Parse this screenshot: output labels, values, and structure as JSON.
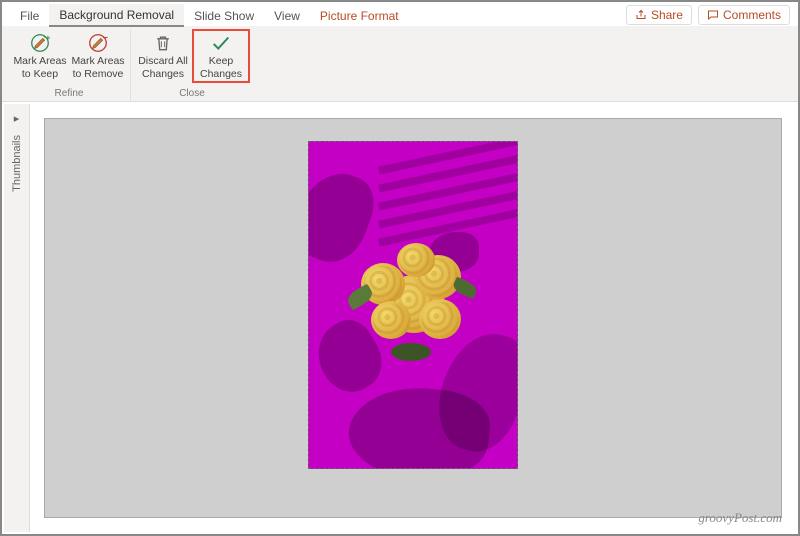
{
  "tabs": {
    "file": "File",
    "bg_removal": "Background Removal",
    "slideshow": "Slide Show",
    "view": "View",
    "picture_format": "Picture Format"
  },
  "actions": {
    "share": "Share",
    "comments": "Comments"
  },
  "ribbon": {
    "refine": {
      "label": "Refine",
      "mark_keep_l1": "Mark Areas",
      "mark_keep_l2": "to Keep",
      "mark_remove_l1": "Mark Areas",
      "mark_remove_l2": "to Remove"
    },
    "close": {
      "label": "Close",
      "discard_l1": "Discard All",
      "discard_l2": "Changes",
      "keep_l1": "Keep",
      "keep_l2": "Changes"
    }
  },
  "thumbnails": {
    "label": "Thumbnails"
  },
  "watermark": "groovyPost.com",
  "icons": {
    "pencil_plus": "pencil-plus-icon",
    "pencil_minus": "pencil-minus-icon",
    "trash": "trash-icon",
    "check": "check-icon",
    "share": "share-icon",
    "comment": "comment-icon",
    "chevron": "chevron-right-icon"
  },
  "colors": {
    "highlight": "#e74c3c",
    "bg_removal_mask": "#c400c4",
    "accent_green": "#2e8b57",
    "accent_red": "#c0392b"
  }
}
